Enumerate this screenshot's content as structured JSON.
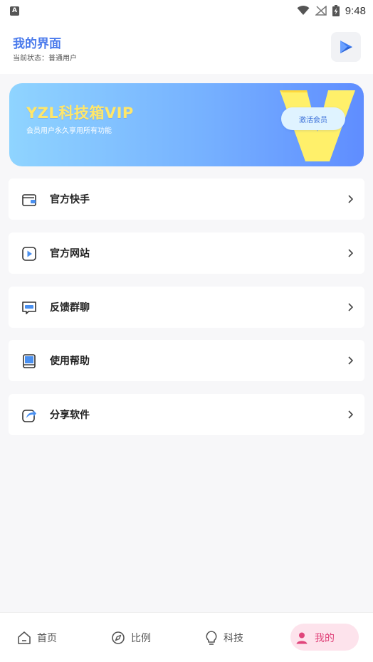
{
  "status_bar": {
    "app_badge": "A",
    "time": "9:48"
  },
  "header": {
    "title": "我的界面",
    "subtitle": "当前状态：普通用户"
  },
  "banner": {
    "title": "YZL科技箱VIP",
    "subtitle": "会员用户永久享用所有功能",
    "badge_letter": "V",
    "button_label": "激活会员"
  },
  "menu": {
    "items": [
      {
        "label": "官方快手",
        "icon": "wallet-icon"
      },
      {
        "label": "官方网站",
        "icon": "play-square-icon"
      },
      {
        "label": "反馈群聊",
        "icon": "chat-icon"
      },
      {
        "label": "使用帮助",
        "icon": "book-icon"
      },
      {
        "label": "分享软件",
        "icon": "share-icon"
      }
    ]
  },
  "bottom_nav": {
    "items": [
      {
        "label": "首页",
        "icon": "home-icon"
      },
      {
        "label": "比例",
        "icon": "compass-icon"
      },
      {
        "label": "科技",
        "icon": "bulb-icon"
      },
      {
        "label": "我的",
        "icon": "user-icon"
      }
    ],
    "active_index": 3
  },
  "colors": {
    "accent": "#4b7bec",
    "banner_title": "#ffe76a",
    "nav_active": "#e0457b"
  }
}
